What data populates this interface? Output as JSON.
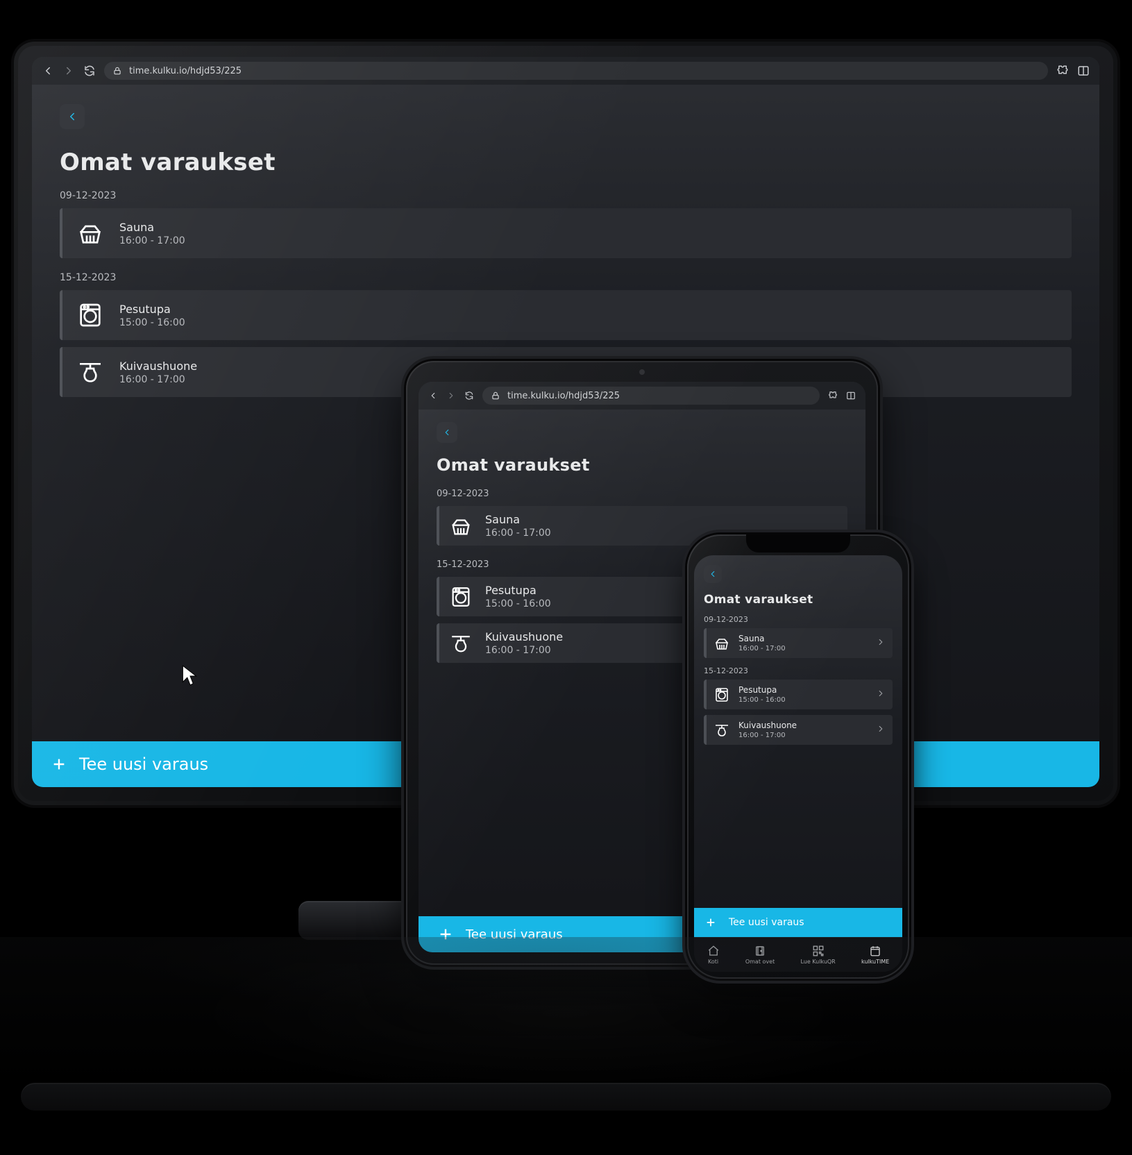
{
  "colors": {
    "accent": "#18b7e6"
  },
  "browser": {
    "url": "time.kulku.io/hdjd53/225"
  },
  "page": {
    "title": "Omat varaukset",
    "cta_label": "Tee uusi varaus",
    "groups": [
      {
        "date": "09-12-2023",
        "bookings": [
          {
            "name": "Sauna",
            "time": "16:00 - 17:00",
            "icon": "sauna"
          }
        ]
      },
      {
        "date": "15-12-2023",
        "bookings": [
          {
            "name": "Pesutupa",
            "time": "15:00 - 16:00",
            "icon": "washer"
          },
          {
            "name": "Kuivaushuone",
            "time": "16:00 - 17:00",
            "icon": "drying"
          }
        ]
      }
    ]
  },
  "phone_tabs": [
    {
      "label": "Koti",
      "icon": "home"
    },
    {
      "label": "Omat ovet",
      "icon": "doors"
    },
    {
      "label": "Lue KulkuQR",
      "icon": "qr"
    },
    {
      "label": "kulkuTIME",
      "icon": "calendar",
      "active": true
    }
  ]
}
